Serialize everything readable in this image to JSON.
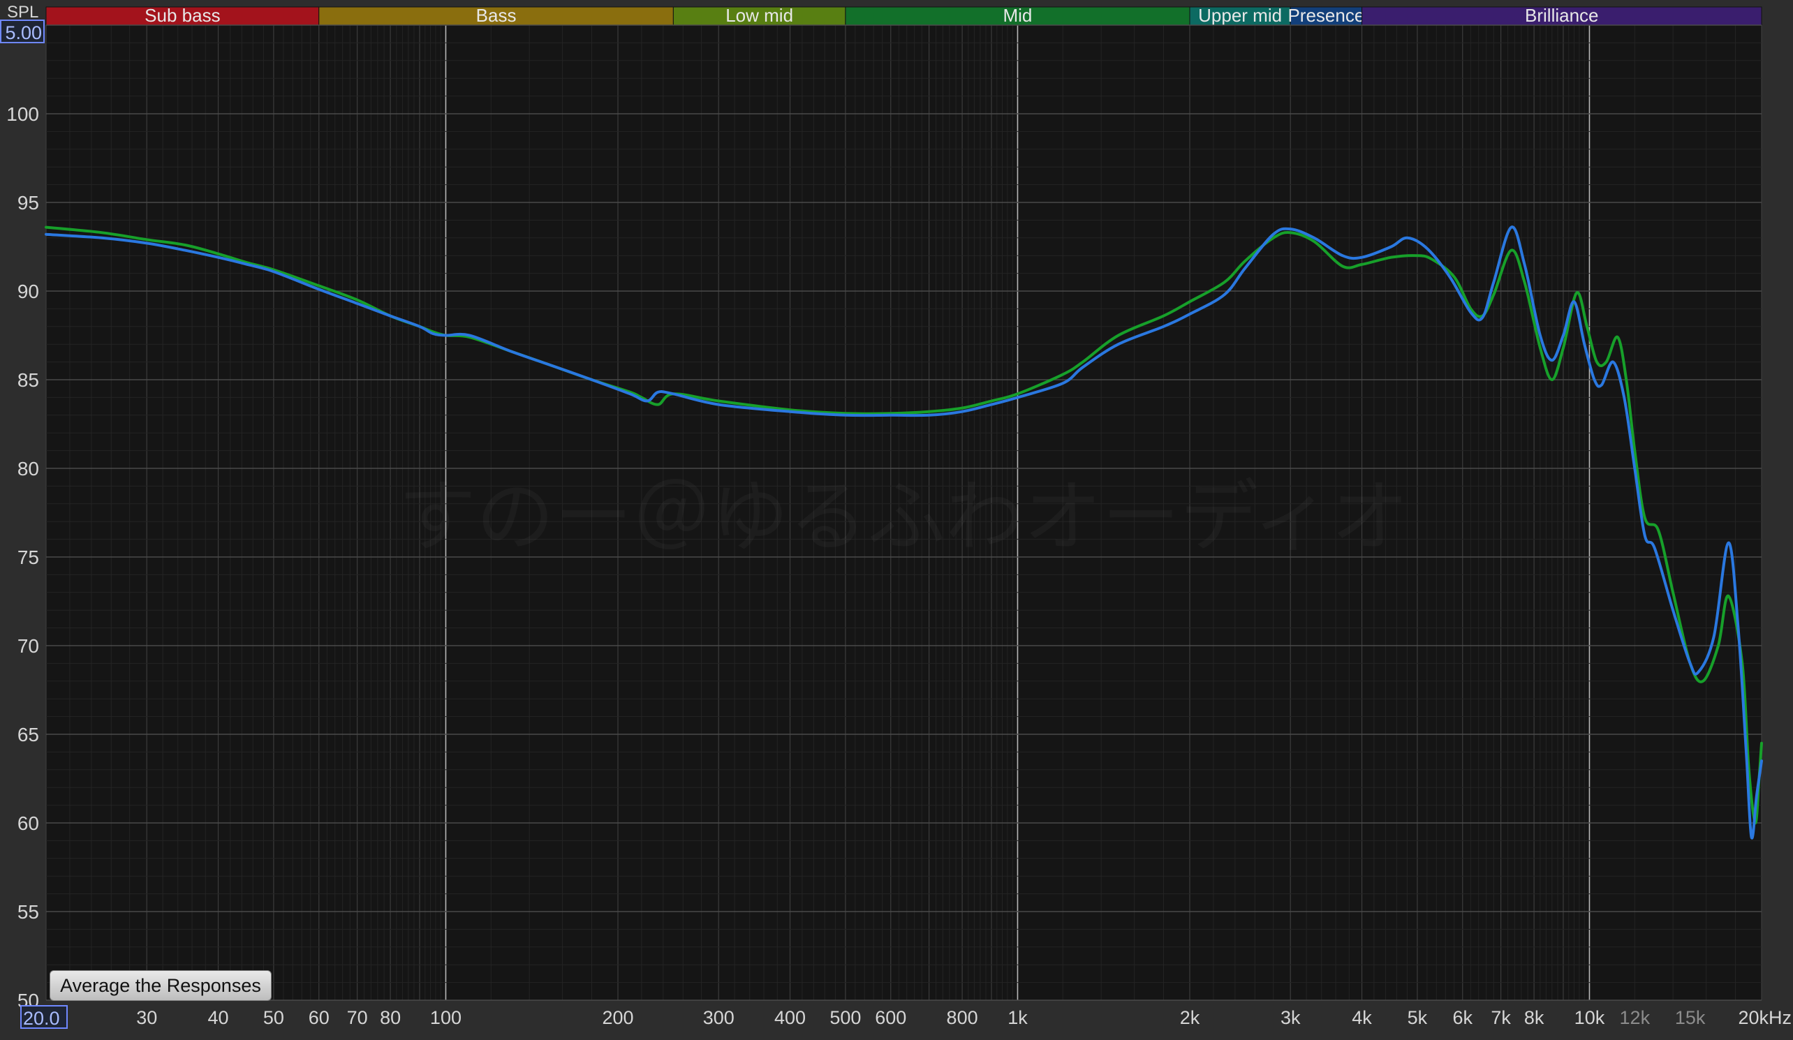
{
  "chart_data": {
    "type": "line",
    "ylabel": "SPL",
    "y_max_readout": "5.00",
    "x_min_readout": "20.0",
    "xscale": "log",
    "xlim": [
      20,
      20000
    ],
    "ylim": [
      50,
      105
    ],
    "grid": true,
    "yticks": [
      {
        "value": 100,
        "label": "100"
      },
      {
        "value": 95,
        "label": "95"
      },
      {
        "value": 90,
        "label": "90"
      },
      {
        "value": 85,
        "label": "85"
      },
      {
        "value": 80,
        "label": "80"
      },
      {
        "value": 75,
        "label": "75"
      },
      {
        "value": 70,
        "label": "70"
      },
      {
        "value": 65,
        "label": "65"
      },
      {
        "value": 60,
        "label": "60"
      },
      {
        "value": 55,
        "label": "55"
      },
      {
        "value": 50,
        "label": "50"
      }
    ],
    "xticks": [
      {
        "value": 30,
        "label": "30"
      },
      {
        "value": 40,
        "label": "40"
      },
      {
        "value": 50,
        "label": "50"
      },
      {
        "value": 60,
        "label": "60"
      },
      {
        "value": 70,
        "label": "70"
      },
      {
        "value": 80,
        "label": "80"
      },
      {
        "value": 100,
        "label": "100"
      },
      {
        "value": 200,
        "label": "200"
      },
      {
        "value": 300,
        "label": "300"
      },
      {
        "value": 400,
        "label": "400"
      },
      {
        "value": 500,
        "label": "500"
      },
      {
        "value": 600,
        "label": "600"
      },
      {
        "value": 800,
        "label": "800"
      },
      {
        "value": 1000,
        "label": "1k"
      },
      {
        "value": 2000,
        "label": "2k"
      },
      {
        "value": 3000,
        "label": "3k"
      },
      {
        "value": 4000,
        "label": "4k"
      },
      {
        "value": 5000,
        "label": "5k"
      },
      {
        "value": 6000,
        "label": "6k"
      },
      {
        "value": 7000,
        "label": "7k"
      },
      {
        "value": 8000,
        "label": "8k"
      },
      {
        "value": 10000,
        "label": "10k"
      },
      {
        "value": 12000,
        "label": "12k",
        "dim": true
      },
      {
        "value": 15000,
        "label": "15k",
        "dim": true
      },
      {
        "value": 20000,
        "label": "20kHz"
      }
    ],
    "major_x_lines": [
      100,
      1000,
      10000
    ],
    "bands": [
      {
        "label": "Sub bass",
        "from": 20,
        "to": 60,
        "color": "#a3131c"
      },
      {
        "label": "Bass",
        "from": 60,
        "to": 250,
        "color": "#8a6e0e"
      },
      {
        "label": "Low mid",
        "from": 250,
        "to": 500,
        "color": "#587f12"
      },
      {
        "label": "Mid",
        "from": 500,
        "to": 2000,
        "color": "#12702a"
      },
      {
        "label": "Upper mid",
        "from": 2000,
        "to": 3000,
        "color": "#0c6a62"
      },
      {
        "label": "Presence",
        "from": 3000,
        "to": 4000,
        "color": "#123f7a"
      },
      {
        "label": "Brilliance",
        "from": 4000,
        "to": 20000,
        "color": "#3a1e6e"
      }
    ],
    "series": [
      {
        "color": "#2a78e0",
        "points": [
          [
            20,
            93.2
          ],
          [
            25,
            93.0
          ],
          [
            30,
            92.7
          ],
          [
            35,
            92.3
          ],
          [
            40,
            91.9
          ],
          [
            45,
            91.5
          ],
          [
            50,
            91.1
          ],
          [
            60,
            90.1
          ],
          [
            70,
            89.3
          ],
          [
            80,
            88.6
          ],
          [
            90,
            88.0
          ],
          [
            95,
            87.6
          ],
          [
            100,
            87.5
          ],
          [
            110,
            87.5
          ],
          [
            130,
            86.6
          ],
          [
            150,
            85.9
          ],
          [
            180,
            85.0
          ],
          [
            210,
            84.2
          ],
          [
            225,
            83.8
          ],
          [
            235,
            84.3
          ],
          [
            250,
            84.2
          ],
          [
            300,
            83.6
          ],
          [
            400,
            83.2
          ],
          [
            500,
            83.0
          ],
          [
            600,
            83.0
          ],
          [
            700,
            83.0
          ],
          [
            800,
            83.2
          ],
          [
            900,
            83.6
          ],
          [
            1000,
            84.0
          ],
          [
            1200,
            84.8
          ],
          [
            1300,
            85.7
          ],
          [
            1500,
            87.0
          ],
          [
            1800,
            88.0
          ],
          [
            2000,
            88.7
          ],
          [
            2300,
            89.8
          ],
          [
            2500,
            91.3
          ],
          [
            2800,
            93.2
          ],
          [
            3000,
            93.5
          ],
          [
            3300,
            93.0
          ],
          [
            3700,
            92.0
          ],
          [
            4000,
            91.9
          ],
          [
            4500,
            92.5
          ],
          [
            4800,
            93.0
          ],
          [
            5200,
            92.4
          ],
          [
            5700,
            90.8
          ],
          [
            6200,
            88.8
          ],
          [
            6500,
            88.5
          ],
          [
            6800,
            90.5
          ],
          [
            7300,
            93.6
          ],
          [
            7700,
            91.5
          ],
          [
            8200,
            87.5
          ],
          [
            8600,
            86.1
          ],
          [
            9000,
            87.5
          ],
          [
            9400,
            89.4
          ],
          [
            9800,
            87.0
          ],
          [
            10200,
            85.0
          ],
          [
            10500,
            84.7
          ],
          [
            11000,
            86.0
          ],
          [
            11500,
            84.0
          ],
          [
            12000,
            80.0
          ],
          [
            12500,
            76.2
          ],
          [
            13000,
            75.5
          ],
          [
            14000,
            72.0
          ],
          [
            15000,
            69.0
          ],
          [
            15500,
            68.5
          ],
          [
            16500,
            70.5
          ],
          [
            17500,
            75.8
          ],
          [
            18200,
            71.0
          ],
          [
            18800,
            64.0
          ],
          [
            19200,
            59.2
          ],
          [
            19600,
            61.5
          ],
          [
            20000,
            63.5
          ]
        ]
      },
      {
        "color": "#17a02a",
        "points": [
          [
            20,
            93.6
          ],
          [
            25,
            93.3
          ],
          [
            30,
            92.9
          ],
          [
            35,
            92.6
          ],
          [
            40,
            92.1
          ],
          [
            45,
            91.6
          ],
          [
            50,
            91.2
          ],
          [
            60,
            90.3
          ],
          [
            70,
            89.5
          ],
          [
            80,
            88.6
          ],
          [
            90,
            88.0
          ],
          [
            95,
            87.7
          ],
          [
            100,
            87.5
          ],
          [
            110,
            87.4
          ],
          [
            130,
            86.6
          ],
          [
            150,
            85.9
          ],
          [
            180,
            85.0
          ],
          [
            210,
            84.3
          ],
          [
            220,
            84.0
          ],
          [
            235,
            83.6
          ],
          [
            250,
            84.2
          ],
          [
            300,
            83.8
          ],
          [
            400,
            83.3
          ],
          [
            500,
            83.1
          ],
          [
            600,
            83.1
          ],
          [
            700,
            83.2
          ],
          [
            800,
            83.4
          ],
          [
            900,
            83.8
          ],
          [
            1000,
            84.2
          ],
          [
            1200,
            85.3
          ],
          [
            1300,
            86.0
          ],
          [
            1500,
            87.5
          ],
          [
            1800,
            88.6
          ],
          [
            2000,
            89.4
          ],
          [
            2300,
            90.5
          ],
          [
            2500,
            91.7
          ],
          [
            2800,
            93.0
          ],
          [
            3000,
            93.3
          ],
          [
            3300,
            92.8
          ],
          [
            3700,
            91.4
          ],
          [
            4000,
            91.5
          ],
          [
            4500,
            91.9
          ],
          [
            5000,
            92.0
          ],
          [
            5300,
            91.8
          ],
          [
            5800,
            90.8
          ],
          [
            6200,
            89.0
          ],
          [
            6500,
            88.6
          ],
          [
            6800,
            89.8
          ],
          [
            7300,
            92.3
          ],
          [
            7700,
            90.5
          ],
          [
            8200,
            86.8
          ],
          [
            8600,
            85.0
          ],
          [
            9000,
            86.8
          ],
          [
            9500,
            89.9
          ],
          [
            9900,
            88.0
          ],
          [
            10300,
            86.0
          ],
          [
            10700,
            86.0
          ],
          [
            11200,
            87.4
          ],
          [
            11600,
            85.0
          ],
          [
            12000,
            81.0
          ],
          [
            12500,
            77.2
          ],
          [
            13200,
            76.5
          ],
          [
            14000,
            73.0
          ],
          [
            15000,
            69.0
          ],
          [
            15800,
            68.0
          ],
          [
            16800,
            70.0
          ],
          [
            17500,
            72.8
          ],
          [
            18500,
            69.0
          ],
          [
            19000,
            63.0
          ],
          [
            19500,
            60.0
          ],
          [
            19800,
            62.5
          ],
          [
            20000,
            64.5
          ]
        ]
      }
    ]
  },
  "controls": {
    "average_button_label": "Average the Responses"
  },
  "watermark_text": "すのー＠ゆるふわオーディオ"
}
